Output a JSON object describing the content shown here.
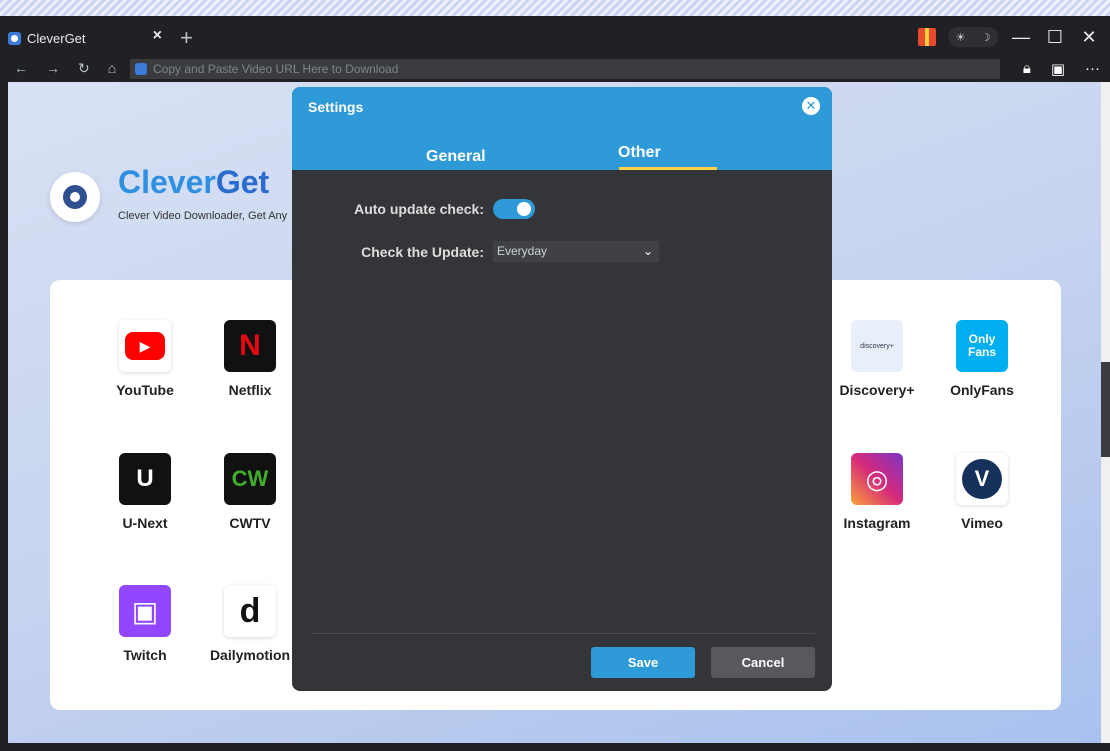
{
  "tab": {
    "title": "CleverGet",
    "close": "×",
    "new": "+"
  },
  "window": {
    "minimize": "—",
    "maximize": "☐",
    "close": "✕",
    "theme_light": "☀",
    "theme_dark": "☽"
  },
  "nav": {
    "back": "←",
    "forward": "→",
    "reload": "↻",
    "home": "⌂",
    "more": "···"
  },
  "address": {
    "placeholder": "Copy and Paste Video URL Here to Download"
  },
  "brand": {
    "name_part1": "Clever",
    "name_part2": "Get",
    "tagline": "Clever Video Downloader, Get Any"
  },
  "sites": [
    {
      "label": "YouTube",
      "color": "#ff0000",
      "glyph": "▶"
    },
    {
      "label": "Netflix",
      "color": "#111111",
      "glyph": "N"
    },
    {
      "label": "Discovery+",
      "color": "#e9eefb",
      "glyph": "discovery+"
    },
    {
      "label": "OnlyFans",
      "color": "#00aff0",
      "glyph": "Only Fans"
    },
    {
      "label": "U-Next",
      "color": "#111111",
      "glyph": "U"
    },
    {
      "label": "CWTV",
      "color": "#111111",
      "glyph": "CW"
    },
    {
      "label": "Instagram",
      "color": "#d6297a",
      "glyph": "◎"
    },
    {
      "label": "Vimeo",
      "color": "#1ab7ea",
      "glyph": "V"
    },
    {
      "label": "Twitch",
      "color": "#9146ff",
      "glyph": "▣"
    },
    {
      "label": "Dailymotion",
      "color": "#ffffff",
      "glyph": "d"
    }
  ],
  "dialog": {
    "title": "Settings",
    "tabs": [
      "General",
      "Other"
    ],
    "active_tab": "Other",
    "auto_update_label": "Auto update check:",
    "auto_update_on": true,
    "check_update_label": "Check the Update:",
    "check_update_value": "Everyday",
    "save": "Save",
    "cancel": "Cancel",
    "accent": "#2e9ad8"
  }
}
